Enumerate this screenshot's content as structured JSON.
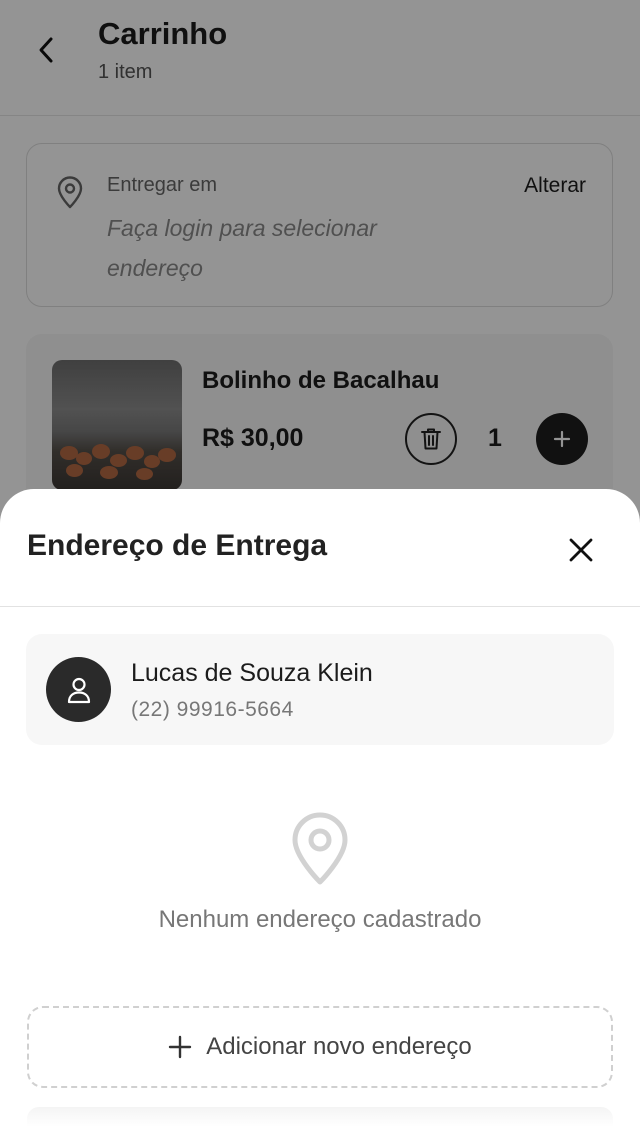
{
  "header": {
    "title": "Carrinho",
    "subtitle": "1 item"
  },
  "delivery": {
    "label": "Entregar em",
    "change_label": "Alterar",
    "address_placeholder": "Faça login para selecionar endereço"
  },
  "cart_item": {
    "name": "Bolinho de Bacalhau",
    "price": "R$ 30,00",
    "quantity": "1"
  },
  "sheet": {
    "title": "Endereço de Entrega",
    "user": {
      "name": "Lucas de Souza Klein",
      "phone": "(22) 99916-5664"
    },
    "empty_state": "Nenhum endereço cadastrado",
    "add_button_label": "Adicionar novo endereço"
  },
  "colors": {
    "dark": "#1e1e1e",
    "muted": "#777777",
    "overlay": "rgba(0,0,0,0.42)"
  }
}
